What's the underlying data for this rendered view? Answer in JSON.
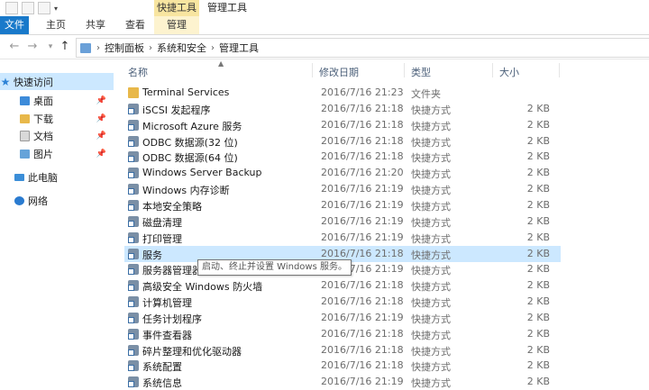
{
  "ribbon": {
    "context_group_title": "快捷工具",
    "window_title": "管理工具",
    "tabs": [
      "文件",
      "主页",
      "共享",
      "查看",
      "管理"
    ]
  },
  "breadcrumbs": [
    "控制面板",
    "系统和安全",
    "管理工具"
  ],
  "navpane": {
    "quick_access": "快速访问",
    "pinned": [
      "桌面",
      "下载",
      "文档",
      "图片"
    ],
    "this_pc": "此电脑",
    "network": "网络"
  },
  "columns": {
    "name": "名称",
    "modified": "修改日期",
    "type": "类型",
    "size": "大小"
  },
  "files": [
    {
      "name": "Terminal Services",
      "date": "2016/7/16 21:23",
      "type": "文件夹",
      "size": ""
    },
    {
      "name": "iSCSI 发起程序",
      "date": "2016/7/16 21:18",
      "type": "快捷方式",
      "size": "2 KB"
    },
    {
      "name": "Microsoft Azure 服务",
      "date": "2016/7/16 21:18",
      "type": "快捷方式",
      "size": "2 KB"
    },
    {
      "name": "ODBC 数据源(32 位)",
      "date": "2016/7/16 21:18",
      "type": "快捷方式",
      "size": "2 KB"
    },
    {
      "name": "ODBC 数据源(64 位)",
      "date": "2016/7/16 21:18",
      "type": "快捷方式",
      "size": "2 KB"
    },
    {
      "name": "Windows Server Backup",
      "date": "2016/7/16 21:20",
      "type": "快捷方式",
      "size": "2 KB"
    },
    {
      "name": "Windows 内存诊断",
      "date": "2016/7/16 21:19",
      "type": "快捷方式",
      "size": "2 KB"
    },
    {
      "name": "本地安全策略",
      "date": "2016/7/16 21:19",
      "type": "快捷方式",
      "size": "2 KB"
    },
    {
      "name": "磁盘清理",
      "date": "2016/7/16 21:19",
      "type": "快捷方式",
      "size": "2 KB"
    },
    {
      "name": "打印管理",
      "date": "2016/7/16 21:19",
      "type": "快捷方式",
      "size": "2 KB"
    },
    {
      "name": "服务",
      "date": "2016/7/16 21:18",
      "type": "快捷方式",
      "size": "2 KB"
    },
    {
      "name": "服务器管理器",
      "date": "2016/7/16 21:19",
      "type": "快捷方式",
      "size": "2 KB"
    },
    {
      "name": "高级安全 Windows 防火墙",
      "date": "2016/7/16 21:18",
      "type": "快捷方式",
      "size": "2 KB"
    },
    {
      "name": "计算机管理",
      "date": "2016/7/16 21:18",
      "type": "快捷方式",
      "size": "2 KB"
    },
    {
      "name": "任务计划程序",
      "date": "2016/7/16 21:19",
      "type": "快捷方式",
      "size": "2 KB"
    },
    {
      "name": "事件查看器",
      "date": "2016/7/16 21:18",
      "type": "快捷方式",
      "size": "2 KB"
    },
    {
      "name": "碎片整理和优化驱动器",
      "date": "2016/7/16 21:18",
      "type": "快捷方式",
      "size": "2 KB"
    },
    {
      "name": "系统配置",
      "date": "2016/7/16 21:18",
      "type": "快捷方式",
      "size": "2 KB"
    },
    {
      "name": "系统信息",
      "date": "2016/7/16 21:19",
      "type": "快捷方式",
      "size": "2 KB"
    }
  ],
  "tooltip": "启动、终止并设置 Windows 服务。",
  "colors": {
    "accent": "#1979ca",
    "selection": "#cce8ff",
    "context_tab": "#f8e5a0"
  }
}
